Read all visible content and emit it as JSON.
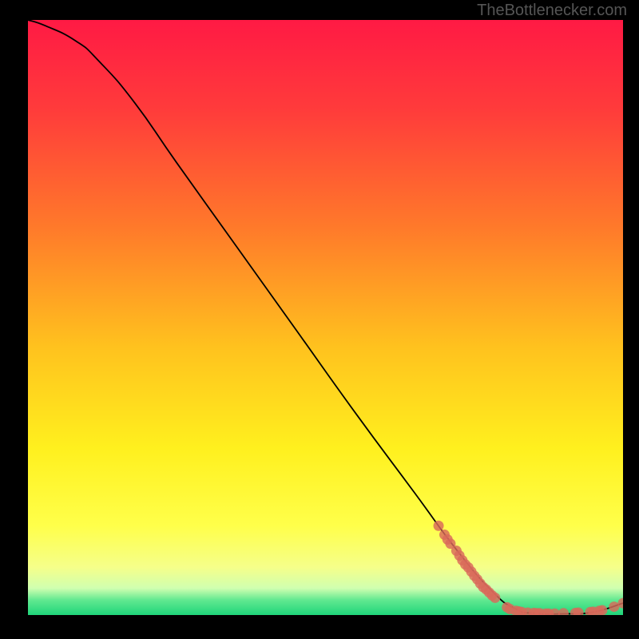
{
  "watermark": "TheBottlenecker.com",
  "chart_data": {
    "type": "line",
    "title": "",
    "xlabel": "",
    "ylabel": "",
    "xlim": [
      0,
      100
    ],
    "ylim": [
      0,
      100
    ],
    "gradient_stops": [
      {
        "offset": 0,
        "color": "#ff1a44"
      },
      {
        "offset": 0.15,
        "color": "#ff3b3b"
      },
      {
        "offset": 0.35,
        "color": "#ff7a2a"
      },
      {
        "offset": 0.55,
        "color": "#ffc21e"
      },
      {
        "offset": 0.72,
        "color": "#fff01e"
      },
      {
        "offset": 0.85,
        "color": "#ffff4a"
      },
      {
        "offset": 0.92,
        "color": "#f5ff8a"
      },
      {
        "offset": 0.955,
        "color": "#d0ffb0"
      },
      {
        "offset": 0.975,
        "color": "#60e890"
      },
      {
        "offset": 1.0,
        "color": "#1fd57a"
      }
    ],
    "curve": [
      {
        "x": 0,
        "y": 100
      },
      {
        "x": 3,
        "y": 99
      },
      {
        "x": 8,
        "y": 96.5
      },
      {
        "x": 12,
        "y": 93
      },
      {
        "x": 18,
        "y": 86
      },
      {
        "x": 25,
        "y": 76
      },
      {
        "x": 35,
        "y": 62
      },
      {
        "x": 45,
        "y": 48
      },
      {
        "x": 55,
        "y": 34
      },
      {
        "x": 65,
        "y": 20.5
      },
      {
        "x": 72,
        "y": 11
      },
      {
        "x": 78,
        "y": 4
      },
      {
        "x": 82,
        "y": 1
      },
      {
        "x": 85,
        "y": 0.3
      },
      {
        "x": 90,
        "y": 0.2
      },
      {
        "x": 95,
        "y": 0.5
      },
      {
        "x": 100,
        "y": 2
      }
    ],
    "data_points": [
      {
        "x": 69,
        "y": 15
      },
      {
        "x": 70,
        "y": 13.5
      },
      {
        "x": 70.5,
        "y": 12.7
      },
      {
        "x": 71,
        "y": 12
      },
      {
        "x": 72,
        "y": 10.8
      },
      {
        "x": 72.5,
        "y": 10
      },
      {
        "x": 73,
        "y": 9.2
      },
      {
        "x": 73.5,
        "y": 8.5
      },
      {
        "x": 74,
        "y": 8
      },
      {
        "x": 74.5,
        "y": 7.3
      },
      {
        "x": 75,
        "y": 6.6
      },
      {
        "x": 75.5,
        "y": 6
      },
      {
        "x": 76,
        "y": 5.3
      },
      {
        "x": 76.5,
        "y": 4.7
      },
      {
        "x": 77,
        "y": 4.3
      },
      {
        "x": 77.5,
        "y": 3.8
      },
      {
        "x": 78,
        "y": 3.3
      },
      {
        "x": 78.5,
        "y": 2.9
      },
      {
        "x": 80.5,
        "y": 1.3
      },
      {
        "x": 81,
        "y": 1
      },
      {
        "x": 82,
        "y": 0.7
      },
      {
        "x": 82.5,
        "y": 0.6
      },
      {
        "x": 83,
        "y": 0.5
      },
      {
        "x": 84,
        "y": 0.4
      },
      {
        "x": 85,
        "y": 0.35
      },
      {
        "x": 85.5,
        "y": 0.3
      },
      {
        "x": 86,
        "y": 0.3
      },
      {
        "x": 87,
        "y": 0.25
      },
      {
        "x": 87.5,
        "y": 0.25
      },
      {
        "x": 88.5,
        "y": 0.25
      },
      {
        "x": 90,
        "y": 0.3
      },
      {
        "x": 92,
        "y": 0.35
      },
      {
        "x": 92.5,
        "y": 0.4
      },
      {
        "x": 94.5,
        "y": 0.5
      },
      {
        "x": 95,
        "y": 0.55
      },
      {
        "x": 96,
        "y": 0.7
      },
      {
        "x": 96.5,
        "y": 0.8
      },
      {
        "x": 98.5,
        "y": 1.4
      },
      {
        "x": 100,
        "y": 2
      }
    ]
  }
}
